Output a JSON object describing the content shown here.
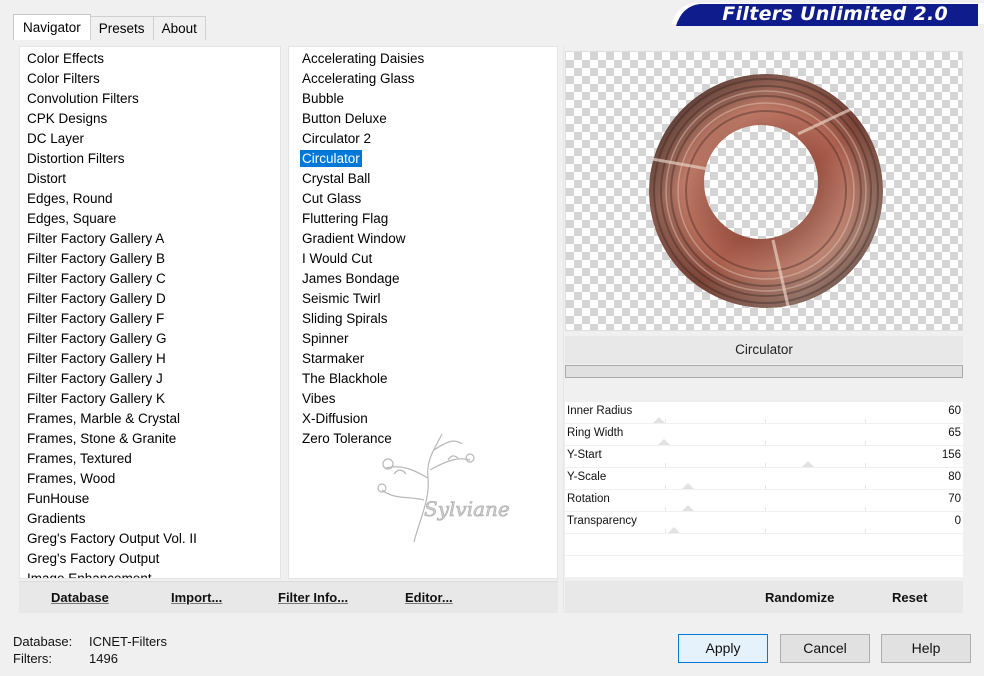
{
  "window": {
    "banner_title": "Filters Unlimited 2.0"
  },
  "tabs": [
    {
      "label": "Navigator",
      "active": true
    },
    {
      "label": "Presets",
      "active": false
    },
    {
      "label": "About",
      "active": false
    }
  ],
  "categories": [
    "Color Effects",
    "Color Filters",
    "Convolution Filters",
    "CPK Designs",
    "DC Layer",
    "Distortion Filters",
    "Distort",
    "Edges, Round",
    "Edges, Square",
    "Filter Factory Gallery A",
    "Filter Factory Gallery B",
    "Filter Factory Gallery C",
    "Filter Factory Gallery D",
    "Filter Factory Gallery F",
    "Filter Factory Gallery G",
    "Filter Factory Gallery H",
    "Filter Factory Gallery J",
    "Filter Factory Gallery K",
    "Frames, Marble & Crystal",
    "Frames, Stone & Granite",
    "Frames, Textured",
    "Frames, Wood",
    "FunHouse",
    "Gradients",
    "Greg's Factory Output Vol. II",
    "Greg's Factory Output",
    "Image Enhancement"
  ],
  "filters": [
    "Accelerating Daisies",
    "Accelerating Glass",
    "Bubble",
    "Button Deluxe",
    "Circulator 2",
    "Circulator",
    "Crystal Ball",
    "Cut Glass",
    "Fluttering Flag",
    "Gradient Window",
    "I Would Cut",
    "James Bondage",
    "Seismic Twirl",
    "Sliding Spirals",
    "Spinner",
    "Starmaker",
    "The Blackhole",
    "Vibes",
    "X-Diffusion",
    "Zero Tolerance"
  ],
  "selected_filter": "Circulator",
  "watermark": "Sylviane",
  "left_buttons": {
    "database": "Database",
    "import": "Import...",
    "filter_info": "Filter Info...",
    "editor": "Editor..."
  },
  "preview": {
    "filter_name": "Circulator"
  },
  "params": [
    {
      "label": "Inner Radius",
      "value": "60"
    },
    {
      "label": "Ring Width",
      "value": "65"
    },
    {
      "label": "Y-Start",
      "value": "156"
    },
    {
      "label": "Y-Scale",
      "value": "80"
    },
    {
      "label": "Rotation",
      "value": "70"
    },
    {
      "label": "Transparency",
      "value": "0"
    }
  ],
  "right_buttons": {
    "randomize": "Randomize",
    "reset": "Reset"
  },
  "status": {
    "database_label": "Database:",
    "database_value": "ICNET-Filters",
    "filters_label": "Filters:",
    "filters_value": "1496"
  },
  "dialog_buttons": {
    "apply": "Apply",
    "cancel": "Cancel",
    "help": "Help"
  },
  "colors": {
    "banner": "#0f1d8c",
    "selection": "#0078d7"
  }
}
